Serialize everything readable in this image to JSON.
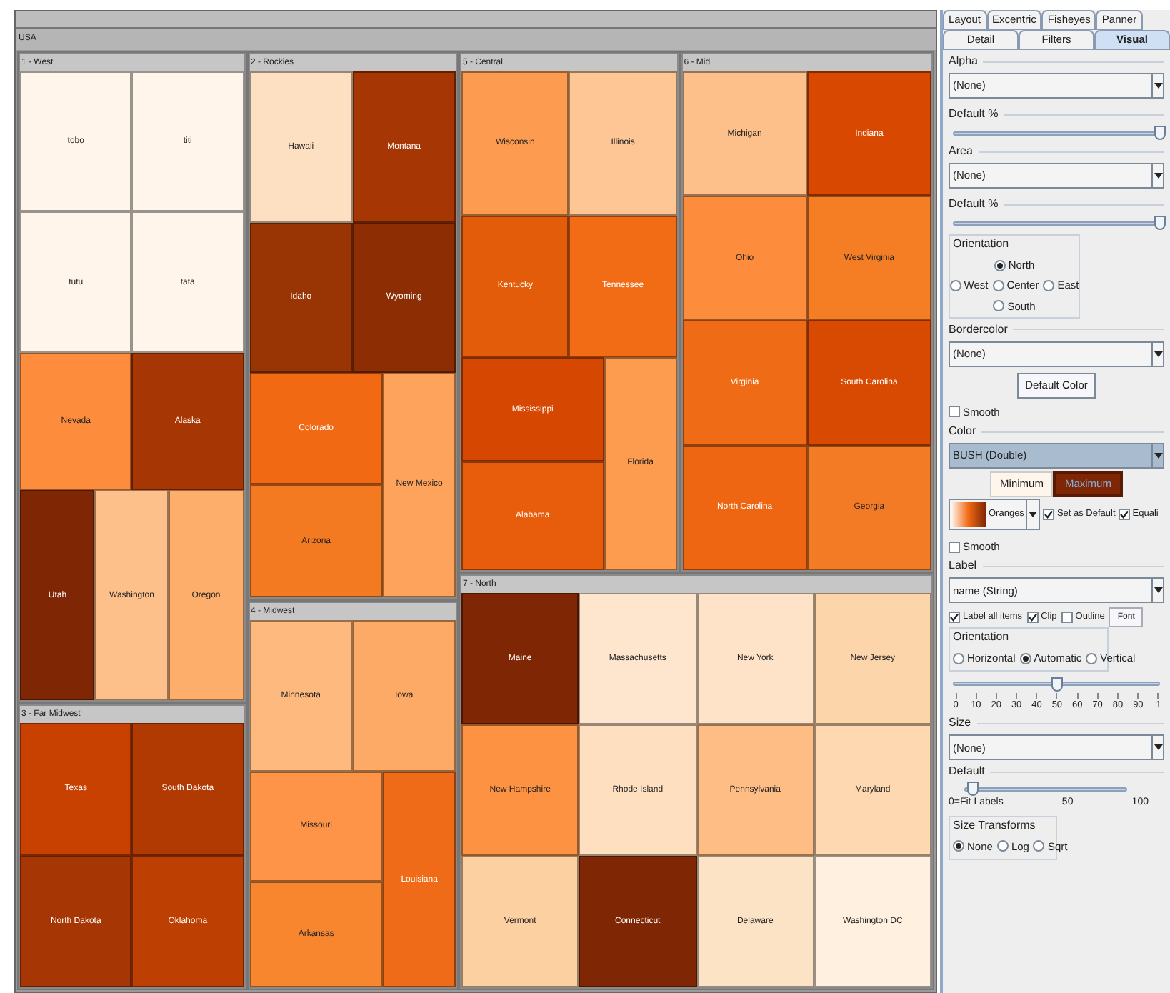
{
  "treemap": {
    "root": "USA",
    "regions": [
      {
        "name": "1 - West",
        "cells": [
          {
            "label": "tobo",
            "color": "#fff5eb"
          },
          {
            "label": "titi",
            "color": "#fff5eb"
          },
          {
            "label": "tutu",
            "color": "#fff5eb"
          },
          {
            "label": "tata",
            "color": "#fff5eb"
          },
          {
            "label": "Nevada",
            "color": "#fd8d3c"
          },
          {
            "label": "Alaska",
            "color": "#a63603"
          },
          {
            "label": "Utah",
            "color": "#7f2704"
          },
          {
            "label": "Washington",
            "color": "#fdc08a"
          },
          {
            "label": "Oregon",
            "color": "#fdae6b"
          }
        ]
      },
      {
        "name": "2 - Rockies",
        "cells": [
          {
            "label": "Hawaii",
            "color": "#fddfc2"
          },
          {
            "label": "Montana",
            "color": "#a63603"
          },
          {
            "label": "Idaho",
            "color": "#993404"
          },
          {
            "label": "Wyoming",
            "color": "#8c2d04"
          },
          {
            "label": "Colorado",
            "color": "#f16913"
          },
          {
            "label": "Arizona",
            "color": "#f47a22"
          },
          {
            "label": "New Mexico",
            "color": "#fda35c"
          }
        ]
      },
      {
        "name": "3 - Far Midwest",
        "cells": [
          {
            "label": "Texas",
            "color": "#c94101"
          },
          {
            "label": "South Dakota",
            "color": "#b13a02"
          },
          {
            "label": "North Dakota",
            "color": "#a63603"
          },
          {
            "label": "Oklahoma",
            "color": "#bd3f02"
          }
        ]
      },
      {
        "name": "4 - Midwest",
        "cells": [
          {
            "label": "Minnesota",
            "color": "#fdb97e"
          },
          {
            "label": "Iowa",
            "color": "#fdaa66"
          },
          {
            "label": "Missouri",
            "color": "#fd9447"
          },
          {
            "label": "Arkansas",
            "color": "#f8862f"
          },
          {
            "label": "Louisiana",
            "color": "#ef6b18"
          }
        ]
      },
      {
        "name": "5 - Central",
        "cells": [
          {
            "label": "Wisconsin",
            "color": "#fd9c50"
          },
          {
            "label": "Illinois",
            "color": "#fdc694"
          },
          {
            "label": "Kentucky",
            "color": "#e35c09"
          },
          {
            "label": "Tennessee",
            "color": "#f26c16"
          },
          {
            "label": "Mississippi",
            "color": "#d64701"
          },
          {
            "label": "Alabama",
            "color": "#e85d0b"
          },
          {
            "label": "Florida",
            "color": "#fd9b4f"
          }
        ]
      },
      {
        "name": "6 - Mid",
        "cells": [
          {
            "label": "Michigan",
            "color": "#fdc08a"
          },
          {
            "label": "Indiana",
            "color": "#d94801"
          },
          {
            "label": "Ohio",
            "color": "#fd8d3c"
          },
          {
            "label": "West Virginia",
            "color": "#f57e25"
          },
          {
            "label": "Virginia",
            "color": "#f06b16"
          },
          {
            "label": "South Carolina",
            "color": "#d84a02"
          },
          {
            "label": "North Carolina",
            "color": "#ef6612"
          },
          {
            "label": "Georgia",
            "color": "#f47b26"
          }
        ]
      },
      {
        "name": "7 - North",
        "cells": [
          {
            "label": "Maine",
            "color": "#7f2704"
          },
          {
            "label": "Massachusetts",
            "color": "#fee6ce"
          },
          {
            "label": "New York",
            "color": "#fee3c8"
          },
          {
            "label": "New Jersey",
            "color": "#fdd5ab"
          },
          {
            "label": "New Hampshire",
            "color": "#fd9242"
          },
          {
            "label": "Rhode Island",
            "color": "#fee0c0"
          },
          {
            "label": "Pennsylvania",
            "color": "#fdbd85"
          },
          {
            "label": "Maryland",
            "color": "#fdd8b0"
          },
          {
            "label": "Vermont",
            "color": "#fdd0a2"
          },
          {
            "label": "Connecticut",
            "color": "#7f2704"
          },
          {
            "label": "Delaware",
            "color": "#fde3c6"
          },
          {
            "label": "Washington DC",
            "color": "#fff0e0"
          }
        ]
      }
    ]
  },
  "panel": {
    "tabs_top": [
      {
        "label": "Layout",
        "selected": false
      },
      {
        "label": "Excentric",
        "selected": false
      },
      {
        "label": "Fisheyes",
        "selected": false
      },
      {
        "label": "Panner",
        "selected": false
      }
    ],
    "tabs": [
      {
        "label": "Detail",
        "selected": false
      },
      {
        "label": "Filters",
        "selected": false
      },
      {
        "label": "Visual",
        "selected": true
      }
    ],
    "alpha": {
      "title": "Alpha",
      "select": "(None)",
      "default_label": "Default %",
      "level": 1
    },
    "area": {
      "title": "Area",
      "select": "(None)",
      "default_label": "Default %",
      "level": 1
    },
    "orientation": {
      "title": "Orientation",
      "options": [
        {
          "label": "North",
          "selected": true
        },
        {
          "label": "West",
          "selected": false
        },
        {
          "label": "Center",
          "selected": false
        },
        {
          "label": "East",
          "selected": false
        },
        {
          "label": "South",
          "selected": false
        }
      ]
    },
    "bordercolor": {
      "title": "Bordercolor",
      "select": "(None)",
      "button": "Default Color",
      "smooth": {
        "label": "Smooth",
        "checked": false
      }
    },
    "color": {
      "title": "Color",
      "select": "BUSH (Double)",
      "ends": [
        {
          "label": "Minimum",
          "color": "#fff5eb",
          "selected": false
        },
        {
          "label": "Maximum",
          "color": "#7f2704",
          "selected": true
        }
      ],
      "palette": "Oranges",
      "set_default": {
        "label": "Set as Default",
        "checked": true
      },
      "equalize": {
        "label": "Equali",
        "checked": true
      },
      "smooth": {
        "label": "Smooth",
        "checked": false
      }
    },
    "label": {
      "title": "Label",
      "select": "name (String)",
      "checks": [
        {
          "label": "Label all items",
          "checked": true
        },
        {
          "label": "Clip",
          "checked": true
        },
        {
          "label": "Outline",
          "checked": false
        }
      ],
      "font_button": "Font",
      "orientation": {
        "title": "Orientation",
        "options": [
          {
            "label": "Horizontal",
            "selected": false
          },
          {
            "label": "Automatic",
            "selected": true
          },
          {
            "label": "Vertical",
            "selected": false
          }
        ]
      },
      "level": 0.5,
      "ticks": [
        "0",
        "10",
        "20",
        "30",
        "40",
        "50",
        "60",
        "70",
        "80",
        "90",
        "1"
      ]
    },
    "size": {
      "title": "Size",
      "select": "(None)",
      "default_title": "Default",
      "level": 0.05,
      "scale": [
        "0=Fit Labels",
        "50",
        "100"
      ],
      "transforms": {
        "title": "Size Transforms",
        "options": [
          {
            "label": "None",
            "selected": true
          },
          {
            "label": "Log",
            "selected": false
          },
          {
            "label": "Sqrt",
            "selected": false
          }
        ]
      }
    }
  }
}
